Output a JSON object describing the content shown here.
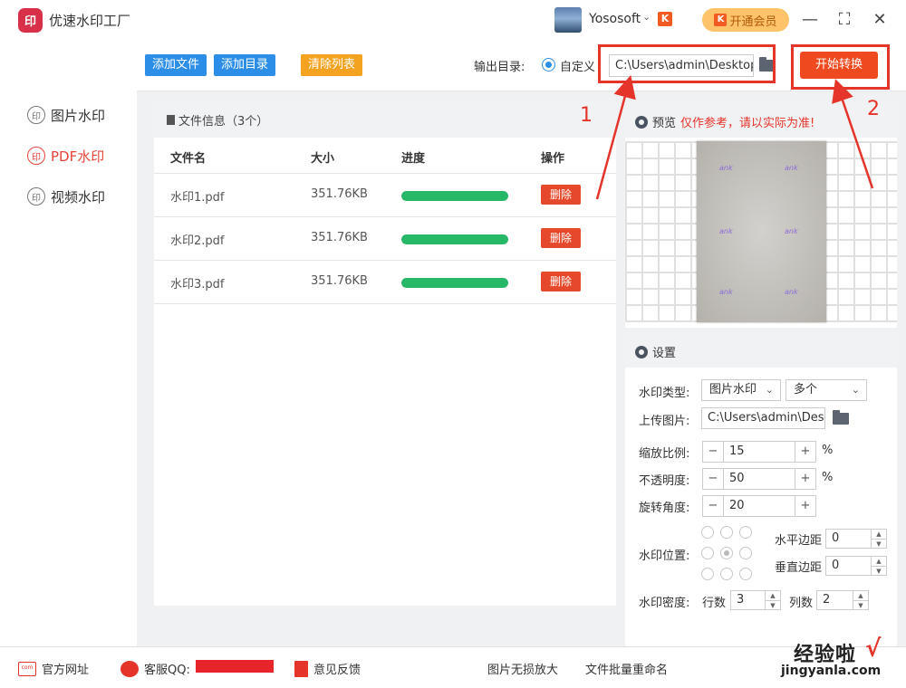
{
  "app": {
    "logo_text": "印",
    "title": "优速水印工厂"
  },
  "user": {
    "name": "Yososoft",
    "vip_label": "开通会员",
    "vip_badge": "K"
  },
  "window": {
    "minimize": "—",
    "maximize": "⛶",
    "close": "✕"
  },
  "sidebar": {
    "items": [
      {
        "label": "图片水印",
        "icon": "印",
        "active": false
      },
      {
        "label": "PDF水印",
        "icon": "印",
        "active": true
      },
      {
        "label": "视频水印",
        "icon": "印",
        "active": false
      }
    ]
  },
  "toolbar": {
    "add_file": "添加文件",
    "add_dir": "添加目录",
    "clear_list": "清除列表",
    "output_label": "输出目录:",
    "custom_label": "自定义",
    "output_path": "C:\\Users\\admin\\Desktop",
    "start_label": "开始转换"
  },
  "file_panel": {
    "header": "文件信息（3个）",
    "columns": {
      "name": "文件名",
      "size": "大小",
      "progress": "进度",
      "action": "操作"
    },
    "rows": [
      {
        "name": "水印1.pdf",
        "size": "351.76KB",
        "progress": 1.0,
        "action": "删除"
      },
      {
        "name": "水印2.pdf",
        "size": "351.76KB",
        "progress": 1.0,
        "action": "删除"
      },
      {
        "name": "水印3.pdf",
        "size": "351.76KB",
        "progress": 1.0,
        "action": "删除"
      }
    ]
  },
  "preview": {
    "title": "预览",
    "note": "仅作参考，请以实际为准!",
    "watermark_text": "ank"
  },
  "settings": {
    "title": "设置",
    "type_label": "水印类型:",
    "type_value": "图片水印",
    "mode_value": "多个",
    "upload_label": "上传图片:",
    "upload_path": "C:\\Users\\admin\\Desktop",
    "scale_label": "缩放比例:",
    "scale_value": "15",
    "opacity_label": "不透明度:",
    "opacity_value": "50",
    "rotate_label": "旋转角度:",
    "rotate_value": "20",
    "percent": "%",
    "minus": "−",
    "plus": "+",
    "position_label": "水印位置:",
    "h_margin_label": "水平边距",
    "h_margin_value": "0",
    "v_margin_label": "垂直边距",
    "v_margin_value": "0",
    "density_label": "水印密度:",
    "rows_label": "行数",
    "rows_value": "3",
    "cols_label": "列数",
    "cols_value": "2"
  },
  "annotations": {
    "one": "1",
    "two": "2"
  },
  "footer": {
    "website": "官方网址",
    "website_icon": "com",
    "qq": "客服QQ:",
    "feedback": "意见反馈",
    "upscale": "图片无损放大",
    "rename": "文件批量重命名"
  },
  "watermark": {
    "brand": "经验啦",
    "check": "√",
    "url": "jingyanla.com"
  },
  "colors": {
    "accent_red": "#e5342a",
    "blue": "#2d8ee8",
    "orange": "#f4a320",
    "green": "#26b866",
    "start": "#ef4a1f"
  }
}
